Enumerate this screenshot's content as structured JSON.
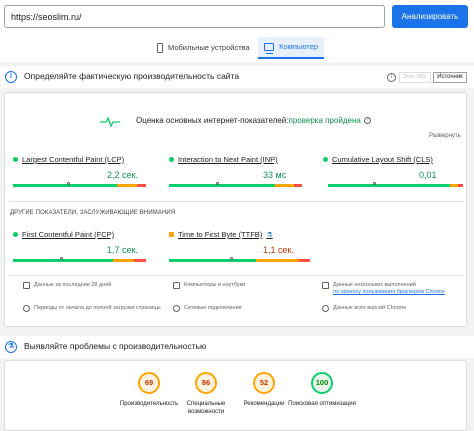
{
  "topbar": {
    "url": "https://seoslim.ru/",
    "analyze_label": "Анализировать"
  },
  "tabs": [
    {
      "label": "Мобильные устройства",
      "icon": "phone-icon",
      "active": false
    },
    {
      "label": "Компьютер",
      "icon": "desktop-icon",
      "active": true
    }
  ],
  "section1": {
    "title": "Определяйте фактическую производительность сайта",
    "origin_label": "Этот URL",
    "source_label": "Источник"
  },
  "cwv": {
    "title_prefix": "Оценка основных интернет-показателей:",
    "status": "проверка пройдена",
    "expand_label": "Развернуть"
  },
  "metrics": [
    {
      "label": "Largest Contentful Paint (LCP)",
      "value": "2,2 сек.",
      "status": "good",
      "marker_fraction": 0.42
    },
    {
      "label": "Interaction to Next Paint (INP)",
      "value": "33 мс",
      "status": "good",
      "marker_fraction": 0.37
    },
    {
      "label": "Cumulative Layout Shift (CLS)",
      "value": "0,01",
      "status": "good",
      "marker_fraction": 0.35
    }
  ],
  "other_title": "ДРУГИЕ ПОКАЗАТЕЛИ, ЗАСЛУЖИВАЮЩИЕ ВНИМАНИЯ",
  "other_metrics": [
    {
      "label": "First Contentful Paint (FCP)",
      "value": "1,7 сек.",
      "status": "good",
      "marker_fraction": 0.37
    },
    {
      "label": "Time to First Byte (TTFB)",
      "value": "1,1 сек.",
      "status": "average",
      "marker_fraction": 0.45
    }
  ],
  "footer": {
    "period": "Данные за последние 28 дней",
    "devices": "Компьютеры и ноутбуки",
    "samples_prefix": "Данные нескольких выполнений",
    "samples_link": "по хроносу пользования браузером Chrome",
    "duration": "Периоды от начала до полной загрузки страницы",
    "network": "Сетевые подключения",
    "versions": "Данные всех версий Chrome"
  },
  "section2": {
    "title": "Выявляйте проблемы с производительностью"
  },
  "scores": [
    {
      "value": "69",
      "label": "Производительность",
      "status": "average"
    },
    {
      "value": "86",
      "label": "Специальные возможности",
      "status": "average"
    },
    {
      "value": "52",
      "label": "Рекомендации",
      "status": "average"
    },
    {
      "value": "100",
      "label": "Поисковая оптимизация",
      "status": "good"
    }
  ],
  "colors": {
    "accent": "#1a73e8",
    "good": "#0cce6b",
    "average": "#ffa400",
    "poor": "#ff4e42"
  }
}
